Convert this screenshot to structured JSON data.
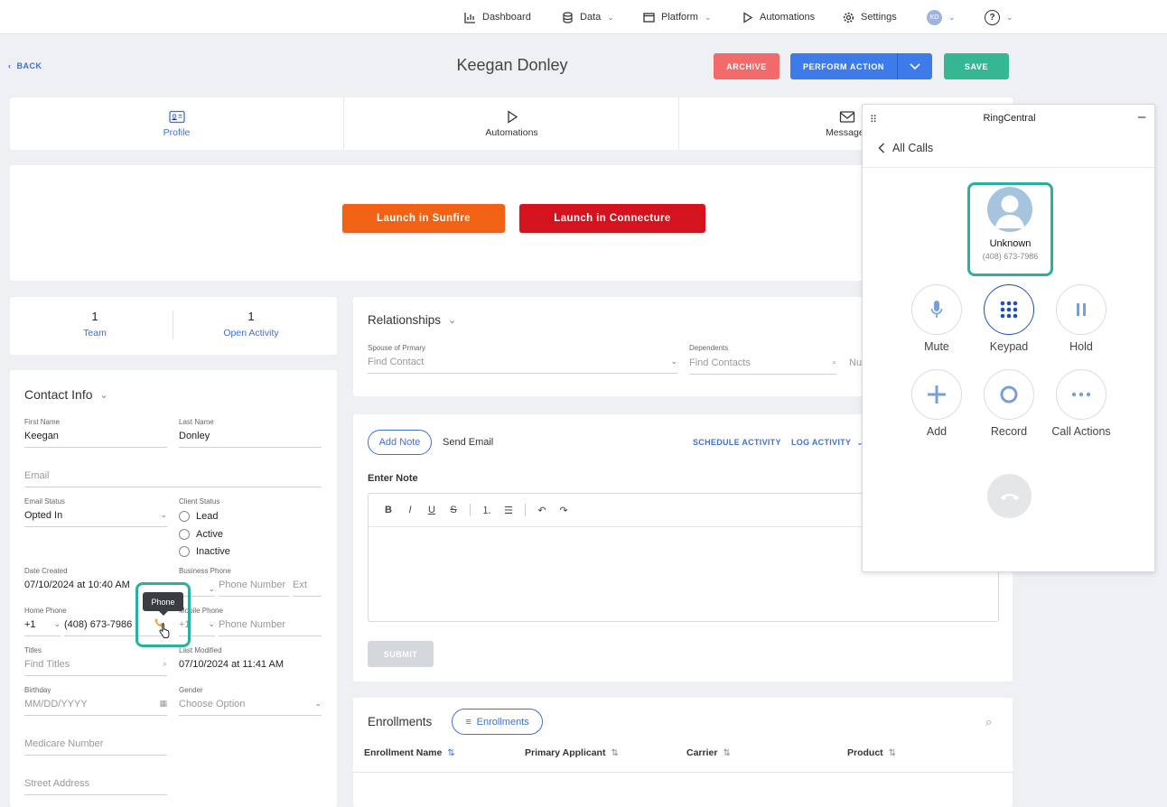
{
  "nav": {
    "dashboard": "Dashboard",
    "data": "Data",
    "platform": "Platform",
    "automations": "Automations",
    "settings": "Settings",
    "avatar_initials": "KD",
    "help": "?"
  },
  "header": {
    "back": "BACK",
    "title": "Keegan Donley",
    "archive": "ARCHIVE",
    "perform_action": "PERFORM ACTION",
    "save": "SAVE"
  },
  "tabs": [
    "Profile",
    "Automations",
    "Messages"
  ],
  "launch": {
    "sunfire": "Launch in Sunfire",
    "connecture": "Launch in Connecture"
  },
  "stats": [
    {
      "count": "1",
      "label": "Team"
    },
    {
      "count": "1",
      "label": "Open Activity"
    }
  ],
  "contact": {
    "title": "Contact Info",
    "first_name_label": "First Name",
    "first_name": "Keegan",
    "last_name_label": "Last Name",
    "last_name": "Donley",
    "email_placeholder": "Email",
    "email_status_label": "Email Status",
    "email_status": "Opted In",
    "client_status_label": "Client Status",
    "client_status_options": [
      "Lead",
      "Active",
      "Inactive"
    ],
    "date_created_label": "Date Created",
    "date_created": "07/10/2024 at 10:40 AM",
    "business_phone_label": "Business Phone",
    "phone_number_placeholder": "Phone Number",
    "ext_placeholder": "Ext",
    "home_phone_label": "Home Phone",
    "country_code": "+1",
    "home_phone": "(408) 673-7986",
    "mobile_phone_label": "Mobile Phone",
    "mobile_country_code": "+1",
    "tooltip": "Phone",
    "titles_label": "Titles",
    "titles_placeholder": "Find Titles",
    "last_modified_label": "Last Modified",
    "last_modified": "07/10/2024 at 11:41 AM",
    "birthday_label": "Birthday",
    "birthday_placeholder": "MM/DD/YYYY",
    "gender_label": "Gender",
    "gender_placeholder": "Choose Option",
    "medicare_placeholder": "Medicare Number",
    "street_placeholder": "Street Address"
  },
  "relationships": {
    "title": "Relationships",
    "spouse_label": "Spouse of Prmary",
    "spouse_placeholder": "Find Contact",
    "dependents_label": "Dependents",
    "dependents_placeholder": "Find Contacts",
    "partial_placeholder": "Nu"
  },
  "note": {
    "add_note": "Add Note",
    "send_email": "Send Email",
    "schedule_activity": "SCHEDULE ACTIVITY",
    "log_activity": "LOG ACTIVITY",
    "enter_note": "Enter Note",
    "toolbar": [
      "B",
      "I",
      "U",
      "S"
    ],
    "submit": "SUBMIT"
  },
  "enrollments": {
    "title": "Enrollments",
    "button": "Enrollments",
    "columns": [
      "Enrollment Name",
      "Primary Applicant",
      "Carrier",
      "Product"
    ]
  },
  "ringcentral": {
    "title": "RingCentral",
    "minimize": "–",
    "all_calls": "All Calls",
    "caller_name": "Unknown",
    "caller_number": "(408) 673-7986",
    "controls": [
      "Mute",
      "Keypad",
      "Hold",
      "Add",
      "Record",
      "Call Actions"
    ]
  },
  "colors": {
    "accent": "#3f6fd8",
    "archive": "#f26b6b",
    "perform": "#3d7bea",
    "save": "#36b794",
    "sunfire": "#f26215",
    "connecture": "#d4131e",
    "highlight": "#2ab09f"
  }
}
